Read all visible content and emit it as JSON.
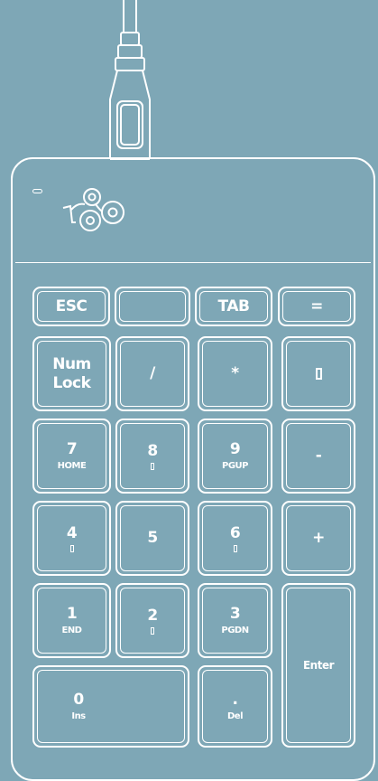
{
  "colors": {
    "background": "#7ea7b6",
    "line": "#ffffff"
  },
  "brand": {
    "logo_text": "rgo"
  },
  "keys": {
    "esc": {
      "label": "ESC"
    },
    "blank": {
      "label": ""
    },
    "tab": {
      "label": "TAB"
    },
    "equals": {
      "label": "="
    },
    "numlock": {
      "line1": "Num",
      "line2": "Lock"
    },
    "slash": {
      "label": "/"
    },
    "asterisk": {
      "label": "*"
    },
    "backspace": {
      "icon": "backspace-icon"
    },
    "k7": {
      "label": "7",
      "sub": "HOME"
    },
    "k8": {
      "label": "8",
      "icon": "arrow-up-icon"
    },
    "k9": {
      "label": "9",
      "sub": "PGUP"
    },
    "minus": {
      "label": "-"
    },
    "k4": {
      "label": "4",
      "icon": "arrow-left-icon"
    },
    "k5": {
      "label": "5"
    },
    "k6": {
      "label": "6",
      "icon": "arrow-right-icon"
    },
    "plus": {
      "label": "+"
    },
    "k1": {
      "label": "1",
      "sub": "END"
    },
    "k2": {
      "label": "2",
      "icon": "arrow-down-icon"
    },
    "k3": {
      "label": "3",
      "sub": "PGDN"
    },
    "enter": {
      "label": "Enter"
    },
    "k0": {
      "label": "0",
      "sub": "Ins"
    },
    "dot": {
      "label": ".",
      "sub": "Del"
    }
  }
}
